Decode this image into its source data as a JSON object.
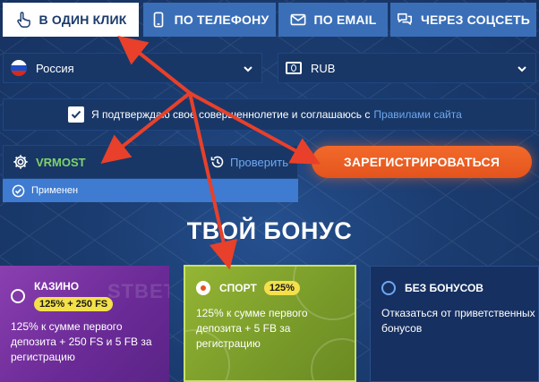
{
  "tabs": {
    "one_click": "В ОДИН КЛИК",
    "phone": "ПО ТЕЛЕФОНУ",
    "email": "ПО EMAIL",
    "social": "ЧЕРЕЗ СОЦСЕТЬ"
  },
  "form": {
    "country": "Россия",
    "currency": "RUB",
    "agreement_text": "Я подтверждаю свое совершеннолетие и соглашаюсь с",
    "agreement_link": "Правилами сайта",
    "promo_code": "VRMOST",
    "check_label": "Проверить",
    "applied_label": "Применен",
    "register_label": "ЗАРЕГИСТРИРОВАТЬСЯ"
  },
  "bonus": {
    "title": "ТВОЙ БОНУС",
    "cards": [
      {
        "name": "КАЗИНО",
        "badge": "125% + 250 FS",
        "desc": "125% к сумме первого депозита + 250 FS и 5 FB за регистрацию",
        "selected": false
      },
      {
        "name": "СПОРТ",
        "badge": "125%",
        "desc": "125% к сумме первого депозита + 5 FB за регистрацию",
        "selected": true
      },
      {
        "name": "БЕЗ БОНУСОВ",
        "desc": "Отказаться от приветственных бонусов",
        "selected": false
      }
    ]
  },
  "colors": {
    "background": "#1a3a6b",
    "tab": "#3a6fb8",
    "accent_orange": "#e4541d",
    "link": "#6fa8f0",
    "promo_green": "#7fd26a",
    "arrow": "#e8402a"
  },
  "icons": {
    "one_click": "hand-pointer-icon",
    "phone": "phone-icon",
    "email": "envelope-icon",
    "social": "chat-bubbles-icon",
    "country": "russia-flag-icon",
    "currency": "currency-icon",
    "promo": "gear-icon",
    "check": "history-icon",
    "applied": "check-circle-icon"
  }
}
